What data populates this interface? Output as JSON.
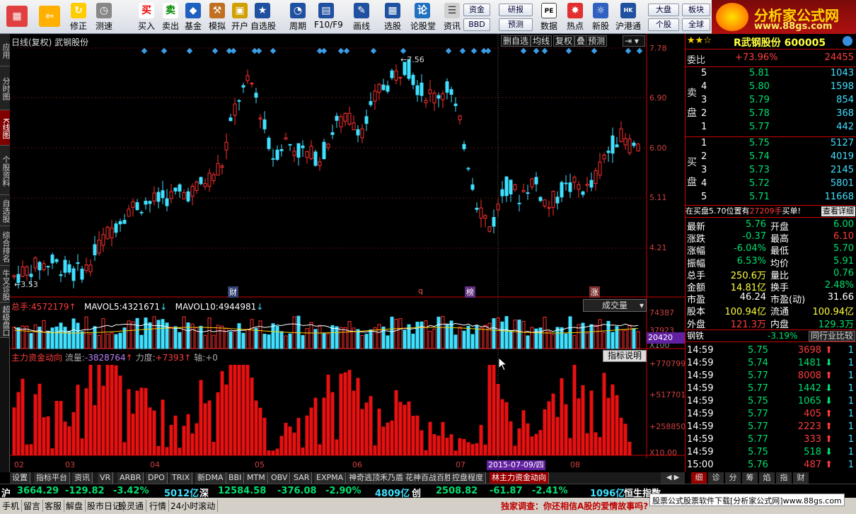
{
  "toolbar": {
    "items": [
      {
        "label": "",
        "icon": "logo-icon"
      },
      {
        "label": "",
        "icon": "back-icon"
      },
      {
        "label": "修正",
        "icon": "refresh-icon"
      },
      {
        "label": "测速",
        "icon": "clock-icon"
      },
      {
        "label": "买入",
        "icon": "buy-icon",
        "glyph": "买"
      },
      {
        "label": "卖出",
        "icon": "sell-icon",
        "glyph": "卖"
      },
      {
        "label": "基金",
        "icon": "fund-icon"
      },
      {
        "label": "模拟",
        "icon": "hammer-icon"
      },
      {
        "label": "开户",
        "icon": "lock-icon"
      },
      {
        "label": "自选股",
        "icon": "star-icon"
      },
      {
        "label": "周期",
        "icon": "cycle-icon"
      },
      {
        "label": "F10/F9",
        "icon": "f10-icon"
      },
      {
        "label": "画线",
        "icon": "pen-icon"
      },
      {
        "label": "选股",
        "icon": "select-icon"
      },
      {
        "label": "论股堂",
        "icon": "forum-icon",
        "glyph": "论"
      },
      {
        "label": "资讯",
        "icon": "news-icon"
      }
    ],
    "small_buttons": [
      "资金",
      "BBD",
      "研报",
      "预测",
      "数据",
      "热点",
      "新股",
      "沪港通",
      "大盘",
      "个股",
      "板块",
      "全球"
    ],
    "logo_title": "分析家公式网",
    "logo_url": "www.88gs.com"
  },
  "lefttabs": [
    "应用",
    "分时图",
    "K线图",
    "个股资料",
    "自选股",
    "综合排名",
    "牛叉诊股",
    "超级盘口"
  ],
  "header": {
    "title": "日线(复权) 武钢股份",
    "buttons": [
      "删自选",
      "均线",
      "复权",
      "叠",
      "预测"
    ]
  },
  "price_axis": [
    "7.78",
    "6.90",
    "6.00",
    "5.11",
    "4.21"
  ],
  "annot": {
    "high": "7.56",
    "low": "3.53",
    "marks": [
      "财",
      "q",
      "榜",
      "涨"
    ]
  },
  "vol": {
    "label": "总手:",
    "total": "4572179",
    "ma5_label": "MAVOL5:",
    "ma5": "4321671",
    "ma10_label": "MAVOL10:",
    "ma10": "4944981",
    "axis": [
      "74387",
      "37923",
      "X100"
    ],
    "cursor": "20420",
    "select": "成交量"
  },
  "flow": {
    "label": "主力资金动向",
    "flow_label": "流量:",
    "flow": "-3828764",
    "force_label": "力度:",
    "force": "+7393",
    "axis_label": "轴:",
    "axis_val": "+0",
    "btn": "指标说明",
    "axis": [
      "+770799",
      "+517701",
      "+258850",
      "X10.00"
    ]
  },
  "date_axis": [
    "02",
    "03",
    "04",
    "05",
    "06",
    "07",
    "08"
  ],
  "date_cursor": "2015-07-09/四",
  "bottom_tabs": [
    "设置",
    "指标平台",
    "资讯",
    "VR",
    "ARBR",
    "DPO",
    "TRIX",
    "新DMA",
    "BBI",
    "MTM",
    "OBV",
    "SAR",
    "EXPMA",
    "神奇逃顶禾乃盾线",
    "花神百战百胜",
    "控盘程度",
    "林主力资金动向"
  ],
  "right": {
    "stock": "R武钢股份 600005",
    "weibi_label": "委比",
    "weibi": "+73.96%",
    "weicha": "24455",
    "sell_label": "卖盘",
    "buy_label": "买盘",
    "asks": [
      [
        "5",
        "5.81",
        "1043"
      ],
      [
        "4",
        "5.80",
        "1598"
      ],
      [
        "3",
        "5.79",
        "854"
      ],
      [
        "2",
        "5.78",
        "368"
      ],
      [
        "1",
        "5.77",
        "442"
      ]
    ],
    "bids": [
      [
        "1",
        "5.75",
        "5127"
      ],
      [
        "2",
        "5.74",
        "4019"
      ],
      [
        "3",
        "5.73",
        "2145"
      ],
      [
        "4",
        "5.72",
        "5801"
      ],
      [
        "5",
        "5.71",
        "11668"
      ]
    ],
    "notice": "在买盘5.70位置有",
    "notice_vol": "27209手",
    "notice_tail": "买单!",
    "notice_btn": "查看详细",
    "quote": [
      [
        "最新",
        "5.76",
        "开盘",
        "6.00"
      ],
      [
        "涨跌",
        "-0.37",
        "最高",
        "6.10"
      ],
      [
        "涨幅",
        "-6.04%",
        "最低",
        "5.70"
      ],
      [
        "振幅",
        "6.53%",
        "均价",
        "5.91"
      ],
      [
        "总手",
        "250.6万",
        "量比",
        "0.76"
      ],
      [
        "金额",
        "14.81亿",
        "换手",
        "2.48%"
      ],
      [
        "市盈",
        "46.24",
        "市盈(动)",
        "31.66"
      ],
      [
        "股本",
        "100.94亿",
        "流通",
        "100.94亿"
      ],
      [
        "外盘",
        "121.3万",
        "内盘",
        "129.3万"
      ]
    ],
    "sector": "钢铁",
    "sector_pct": "-3.19%",
    "sector_btn": "同行业比较",
    "ticks": [
      [
        "14:59",
        "5.75",
        "3698",
        "up",
        "1"
      ],
      [
        "14:59",
        "5.74",
        "1481",
        "down",
        "1"
      ],
      [
        "14:59",
        "5.77",
        "8008",
        "up",
        "1"
      ],
      [
        "14:59",
        "5.77",
        "1442",
        "down",
        "1"
      ],
      [
        "14:59",
        "5.75",
        "1065",
        "down",
        "1"
      ],
      [
        "14:59",
        "5.77",
        "405",
        "up",
        "1"
      ],
      [
        "14:59",
        "5.77",
        "2223",
        "up",
        "1"
      ],
      [
        "14:59",
        "5.77",
        "333",
        "up",
        "1"
      ],
      [
        "14:59",
        "5.75",
        "518",
        "down",
        "1"
      ],
      [
        "15:00",
        "5.76",
        "487",
        "up",
        "1"
      ]
    ],
    "tabs": [
      "细",
      "诊",
      "分",
      "筹",
      "焰",
      "指",
      "财"
    ]
  },
  "index_bar": {
    "sh_label": "沪",
    "sh": "3664.29",
    "sh_chg": "-129.82",
    "sh_pct": "-3.42%",
    "sh_amt": "5012亿",
    "sz_label": "深",
    "sz": "12584.58",
    "sz_chg": "-376.08",
    "sz_pct": "-2.90%",
    "sz_amt": "4809亿",
    "cy_label": "创",
    "cy": "2508.82",
    "cy_chg": "-61.87",
    "cy_pct": "-2.41%",
    "cy_amt": "1096亿",
    "hs_label": "恒生指数"
  },
  "status": [
    "手机",
    "留言",
    "客服",
    "解盘",
    "股市日记",
    "股灵通",
    "行情",
    "24小时滚动"
  ],
  "status_news": "独家调查：你还相信A股的爱情故事吗?",
  "status_ad": "股票公式股票软件下载[分析家公式网]www.88gs.com",
  "chart_data": {
    "type": "candlestick",
    "ylim": [
      3.53,
      7.78
    ],
    "high": 7.56,
    "low": 3.53
  }
}
